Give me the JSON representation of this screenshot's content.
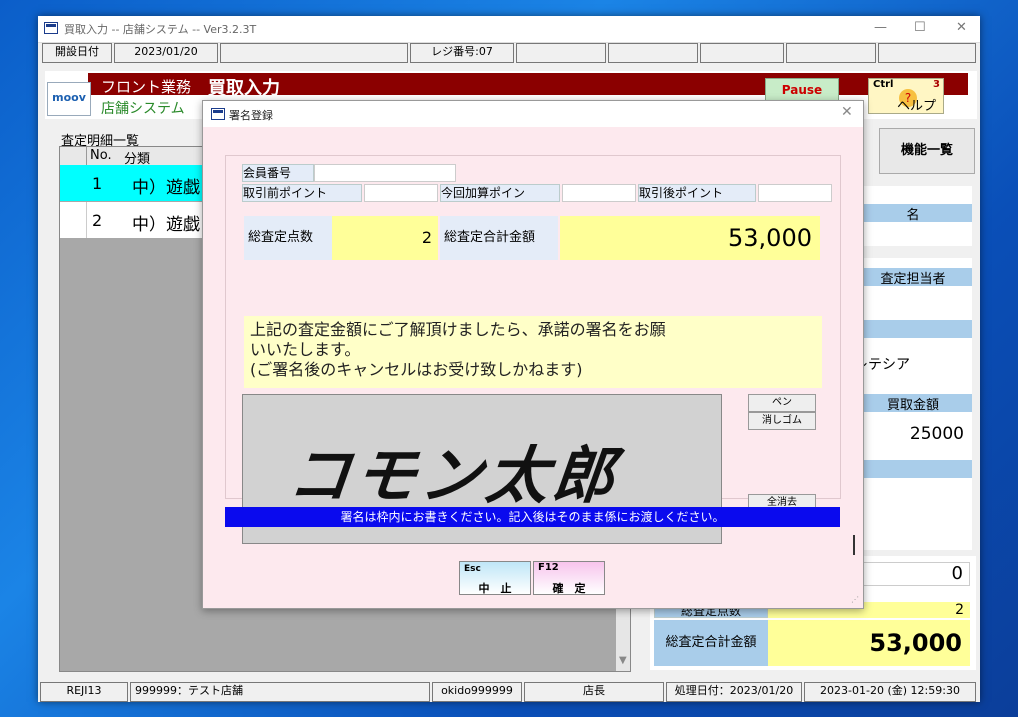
{
  "main_window": {
    "title": "買取入力 -- 店舗システム -- Ver3.2.3T",
    "status": {
      "open_date_label": "開設日付",
      "open_date": "2023/01/20",
      "register_label": "レジ番号:07"
    },
    "header": {
      "section": "フロント業務",
      "screen": "買取入力",
      "system": "店舗システム",
      "logo": "moov",
      "pause_label": "Pause",
      "help_ctrl": "Ctrl",
      "help_num": "3",
      "help_label": "ヘルプ",
      "function_list": "機能一覧"
    },
    "list": {
      "caption": "査定明細一覧",
      "col_no": "No.",
      "col_category": "分類",
      "rows": [
        {
          "no": "1",
          "category": "中）遊戯"
        },
        {
          "no": "2",
          "category": "中）遊戯"
        }
      ]
    },
    "right": {
      "name_label": "名",
      "assessor_label": "査定担当者",
      "assessor_value": "レテシア",
      "purchase_label": "買取金額",
      "purchase_value": "25000"
    },
    "totals": {
      "zero_value": "0",
      "count_label": "総査定点数",
      "count_value": "2",
      "total_label": "総査定合計金額",
      "total_value": "53,000"
    },
    "footer": {
      "reji": "REJI13",
      "store": "999999：テスト店舗",
      "user": "okido999999",
      "role": "店長",
      "process_date": "処理日付：2023/01/20",
      "datetime": "2023-01-20 (金) 12:59:30"
    }
  },
  "dialog": {
    "title": "署名登録",
    "member_no_label": "会員番号",
    "points_before_label": "取引前ポイント",
    "points_added_label": "今回加算ポイン",
    "points_after_label": "取引後ポイント",
    "count_label": "総査定点数",
    "count_value": "2",
    "total_label": "総査定合計金額",
    "total_value": "53,000",
    "notice_line1": "上記の査定金額にご了解頂けましたら、承諾の署名をお願",
    "notice_line2": "いいたします。",
    "notice_line3": "(ご署名後のキャンセルはお受け致しかねます)",
    "signature": "コモン太郎",
    "pen_label": "ペン",
    "eraser_label": "消しゴム",
    "clear_label": "全消去",
    "info": "署名は枠内にお書きください。記入後はそのまま係にお渡しください。",
    "esc_key": "Esc",
    "esc_label": "中　止",
    "f12_key": "F12",
    "f12_label": "確　定"
  }
}
